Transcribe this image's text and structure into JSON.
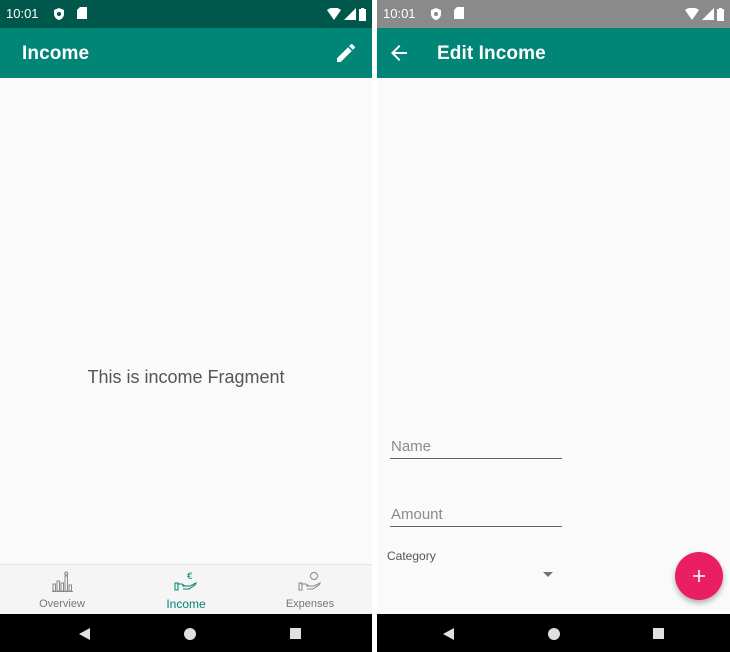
{
  "left_screen": {
    "status_bar": {
      "time": "10:01"
    },
    "app_bar": {
      "title": "Income",
      "action_icon": "edit-pencil-icon"
    },
    "fragment_text": "This is income Fragment",
    "bottom_nav": {
      "items": [
        {
          "label": "Overview",
          "icon": "bar-chart-icon",
          "active": false
        },
        {
          "label": "Income",
          "icon": "euro-hand-icon",
          "active": true
        },
        {
          "label": "Expenses",
          "icon": "dollar-hand-icon",
          "active": false
        }
      ],
      "active_color": "#008577"
    }
  },
  "right_screen": {
    "status_bar": {
      "time": "10:01"
    },
    "app_bar": {
      "title": "Edit Income",
      "nav_icon": "arrow-back-icon"
    },
    "form": {
      "name_placeholder": "Name",
      "amount_placeholder": "Amount",
      "category_label": "Category",
      "category_value": ""
    },
    "fab": {
      "icon": "plus-icon",
      "color": "#e91e63"
    }
  },
  "colors": {
    "primary": "#008577",
    "primary_dark": "#00574b",
    "accent": "#e91e63"
  }
}
